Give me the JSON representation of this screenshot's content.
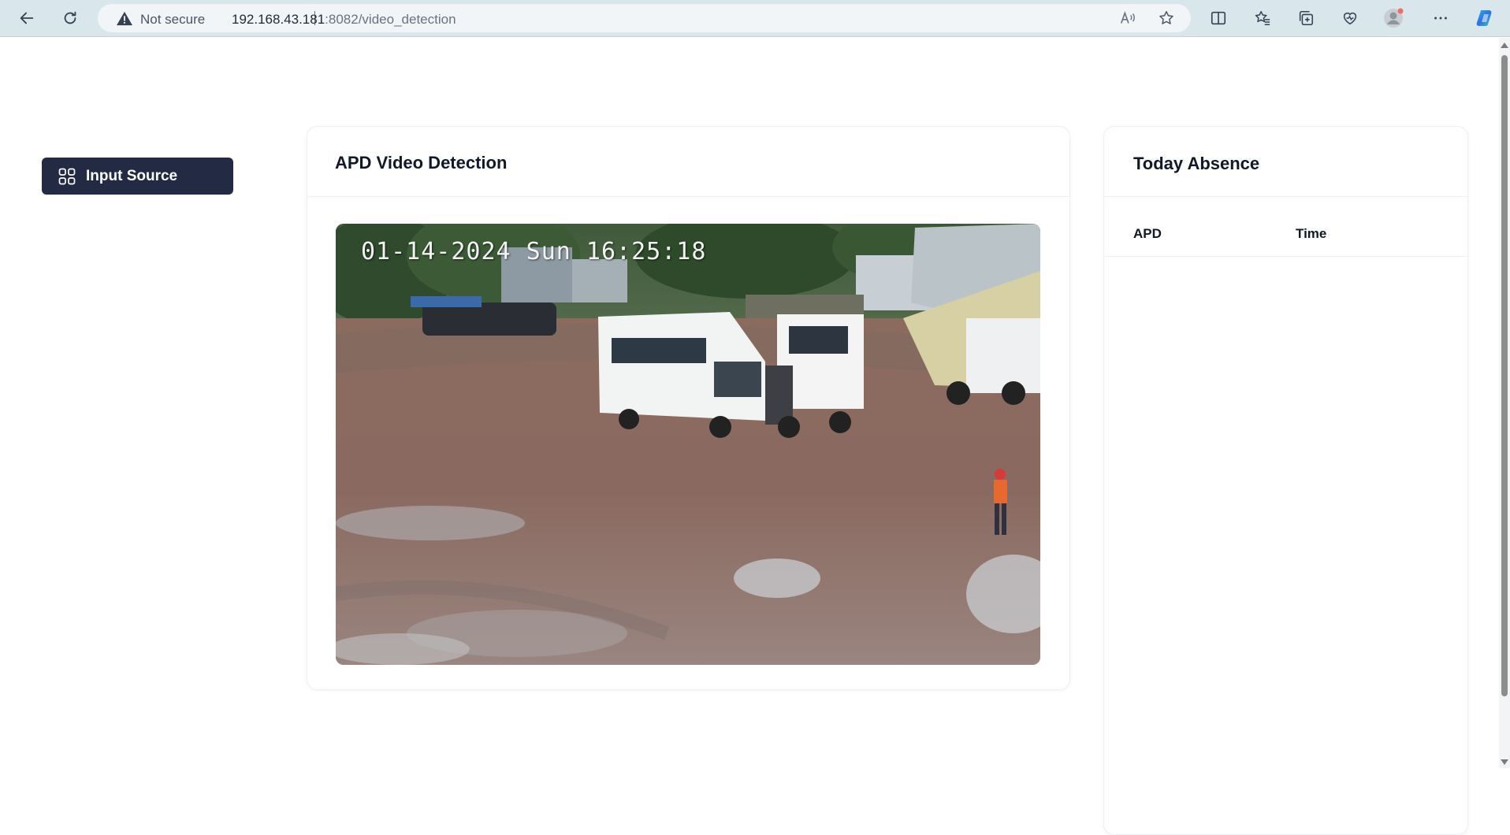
{
  "browser": {
    "security_label": "Not secure",
    "url_host": "192.168.43.181",
    "url_path": ":8082/video_detection",
    "icons": [
      "back-arrow-icon",
      "refresh-icon",
      "warning-icon",
      "read-aloud-icon",
      "favorite-star-icon",
      "split-screen-icon",
      "favorites-icon",
      "collections-icon",
      "browser-essentials-icon",
      "profile-avatar-icon",
      "more-icon",
      "copilot-icon"
    ]
  },
  "sidebar": {
    "input_source_label": "Input Source",
    "input_source_icon": "grid-icon"
  },
  "video_panel": {
    "title": "APD Video Detection",
    "timestamp": "01-14-2024 Sun 16:25:18"
  },
  "absence_panel": {
    "title": "Today Absence",
    "columns": [
      "APD",
      "Time"
    ],
    "rows": []
  },
  "colors": {
    "sidebar_button_bg": "#232a44",
    "chrome_bg": "#d9e7ec"
  }
}
